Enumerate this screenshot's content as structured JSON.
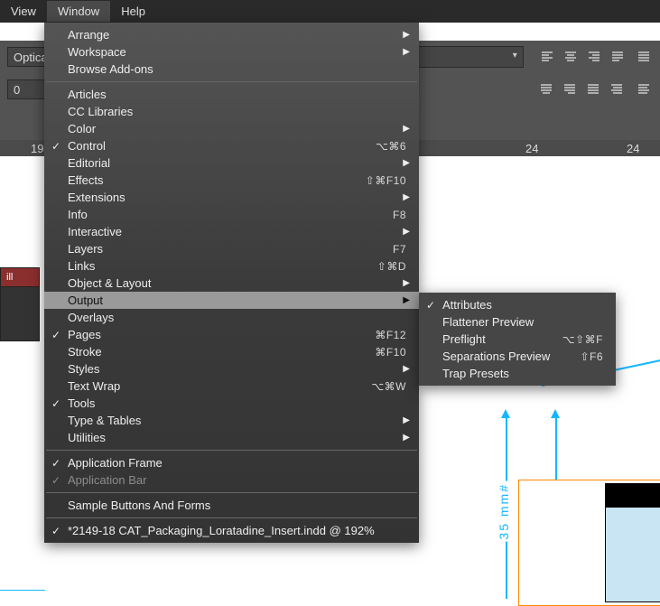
{
  "menubar": {
    "view": "View",
    "window": "Window",
    "help": "Help"
  },
  "toolstrip": {
    "optical": "Optical",
    "num": "0",
    "ruler_ticks": [
      "19",
      "24",
      "24"
    ]
  },
  "tab": {
    "label": "ill"
  },
  "window_menu": {
    "groups": [
      [
        {
          "label": "Arrange",
          "sub": true
        },
        {
          "label": "Workspace",
          "sub": true
        },
        {
          "label": "Browse Add-ons"
        }
      ],
      [
        {
          "label": "Articles"
        },
        {
          "label": "CC Libraries"
        },
        {
          "label": "Color",
          "sub": true
        },
        {
          "label": "Control",
          "check": true,
          "shortcut": "⌥⌘6"
        },
        {
          "label": "Editorial",
          "sub": true
        },
        {
          "label": "Effects",
          "shortcut": "⇧⌘F10"
        },
        {
          "label": "Extensions",
          "sub": true
        },
        {
          "label": "Info",
          "shortcut": "F8"
        },
        {
          "label": "Interactive",
          "sub": true
        },
        {
          "label": "Layers",
          "shortcut": "F7"
        },
        {
          "label": "Links",
          "shortcut": "⇧⌘D"
        },
        {
          "label": "Object & Layout",
          "sub": true
        },
        {
          "label": "Output",
          "sub": true,
          "highlight": true
        },
        {
          "label": "Overlays"
        },
        {
          "label": "Pages",
          "check": true,
          "shortcut": "⌘F12"
        },
        {
          "label": "Stroke",
          "shortcut": "⌘F10"
        },
        {
          "label": "Styles",
          "sub": true
        },
        {
          "label": "Text Wrap",
          "shortcut": "⌥⌘W"
        },
        {
          "label": "Tools",
          "check": true
        },
        {
          "label": "Type & Tables",
          "sub": true
        },
        {
          "label": "Utilities",
          "sub": true
        }
      ],
      [
        {
          "label": "Application Frame",
          "check": true
        },
        {
          "label": "Application Bar",
          "check": true,
          "disabled": true
        }
      ],
      [
        {
          "label": "Sample Buttons And Forms"
        }
      ],
      [
        {
          "label": "*2149-18 CAT_Packaging_Loratadine_Insert.indd @ 192%",
          "check": true
        }
      ]
    ]
  },
  "output_submenu": [
    {
      "label": "Attributes",
      "check": true
    },
    {
      "label": "Flattener Preview"
    },
    {
      "label": "Preflight",
      "shortcut": "⌥⇧⌘F"
    },
    {
      "label": "Separations Preview",
      "shortcut": "⇧F6"
    },
    {
      "label": "Trap Presets"
    }
  ],
  "canvas": {
    "dim_label": "35 mm#"
  }
}
